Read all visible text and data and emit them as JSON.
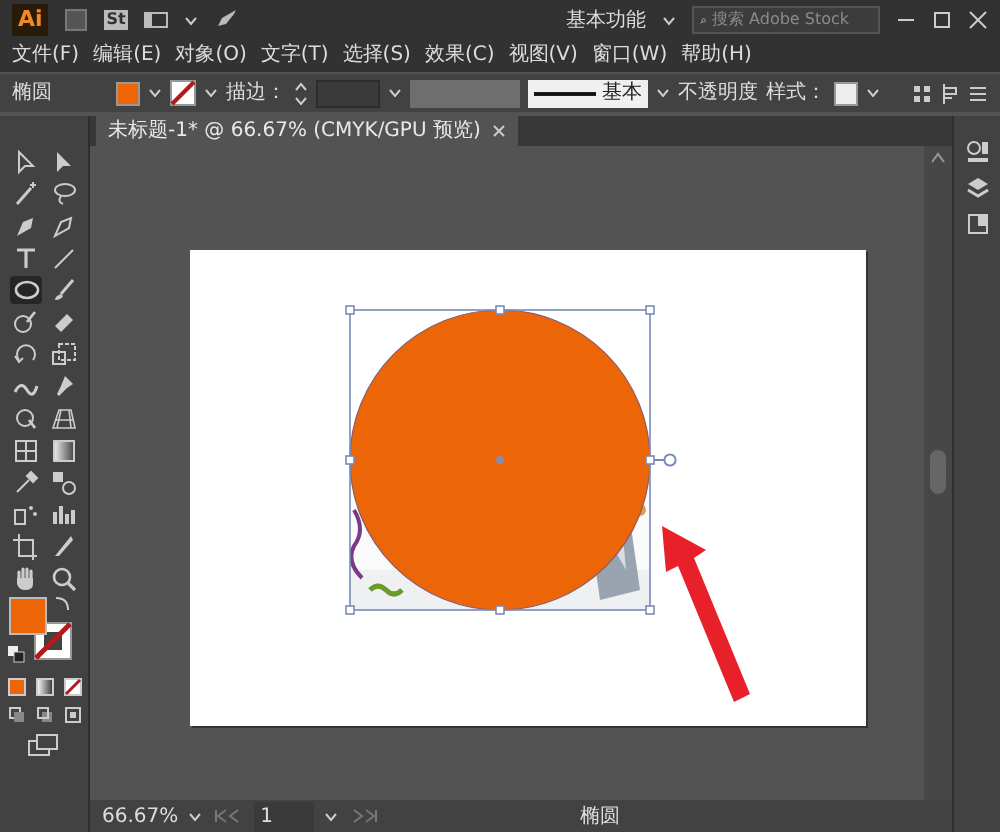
{
  "app": {
    "logo": "Ai",
    "stock_badge": "St"
  },
  "workspace": "基本功能",
  "search": {
    "placeholder": "搜索 Adobe Stock"
  },
  "menu": [
    "文件(F)",
    "编辑(E)",
    "对象(O)",
    "文字(T)",
    "选择(S)",
    "效果(C)",
    "视图(V)",
    "窗口(W)",
    "帮助(H)"
  ],
  "control_bar": {
    "tool_label": "椭圆",
    "stroke_label": "描边：",
    "stroke_style": "基本",
    "opacity_label": "不透明度",
    "style_label": "样式："
  },
  "document_tab": {
    "title": "未标题-1* @ 66.67% (CMYK/GPU 预览)"
  },
  "tools": [
    {
      "selected": false
    },
    {
      "selected": false
    },
    {
      "selected": false
    },
    {
      "selected": false
    },
    {
      "selected": false
    },
    {
      "selected": false
    },
    {
      "selected": false
    },
    {
      "selected": false
    },
    {
      "selected": true
    },
    {
      "selected": false
    },
    {
      "selected": false
    },
    {
      "selected": false
    },
    {
      "selected": false
    },
    {
      "selected": false
    },
    {
      "selected": false
    },
    {
      "selected": false
    },
    {
      "selected": false
    },
    {
      "selected": false
    },
    {
      "selected": false
    },
    {
      "selected": false
    },
    {
      "selected": false
    },
    {
      "selected": false
    },
    {
      "selected": false
    },
    {
      "selected": false
    },
    {
      "selected": false
    },
    {
      "selected": false
    },
    {
      "selected": false
    },
    {
      "selected": false
    }
  ],
  "status_bar": {
    "zoom": "66.67%",
    "artboard": "1",
    "tool": "椭圆"
  }
}
